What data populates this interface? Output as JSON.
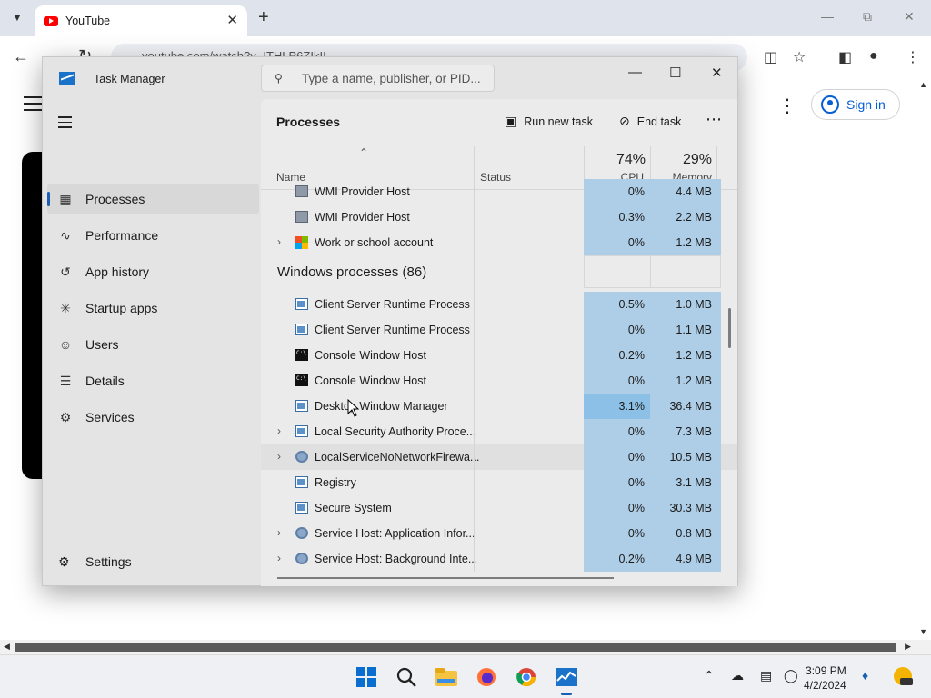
{
  "browser": {
    "tab_title": "YouTube",
    "url": "youtube.com/watch?v=ITHLP6ZIkII",
    "signin_label": "Sign in"
  },
  "tm": {
    "title": "Task Manager",
    "search_placeholder": "Type a name, publisher, or PID...",
    "nav": [
      {
        "label": "Processes",
        "icon": "processes-icon"
      },
      {
        "label": "Performance",
        "icon": "performance-icon"
      },
      {
        "label": "App history",
        "icon": "app-history-icon"
      },
      {
        "label": "Startup apps",
        "icon": "startup-apps-icon"
      },
      {
        "label": "Users",
        "icon": "users-icon"
      },
      {
        "label": "Details",
        "icon": "details-icon"
      },
      {
        "label": "Services",
        "icon": "services-icon"
      }
    ],
    "settings_label": "Settings",
    "heading": "Processes",
    "run_new_task": "Run new task",
    "end_task": "End task",
    "columns": {
      "name": "Name",
      "status": "Status",
      "cpu_pct": "74%",
      "cpu": "CPU",
      "mem_pct": "29%",
      "memory": "Memory"
    },
    "top_rows": [
      {
        "name": "WMI Provider Host",
        "cpu": "0%",
        "mem": "4.4 MB",
        "icon": "wmi"
      },
      {
        "name": "WMI Provider Host",
        "cpu": "0.3%",
        "mem": "2.2 MB",
        "icon": "wmi"
      },
      {
        "name": "Work or school account",
        "cpu": "0%",
        "mem": "1.2 MB",
        "icon": "ms",
        "expand": true
      }
    ],
    "section_title": "Windows processes (86)",
    "rows": [
      {
        "name": "Client Server Runtime Process",
        "cpu": "0.5%",
        "mem": "1.0 MB",
        "icon": "app"
      },
      {
        "name": "Client Server Runtime Process",
        "cpu": "0%",
        "mem": "1.1 MB",
        "icon": "app"
      },
      {
        "name": "Console Window Host",
        "cpu": "0.2%",
        "mem": "1.2 MB",
        "icon": "console"
      },
      {
        "name": "Console Window Host",
        "cpu": "0%",
        "mem": "1.2 MB",
        "icon": "console"
      },
      {
        "name": "Desktop Window Manager",
        "cpu": "3.1%",
        "mem": "36.4 MB",
        "icon": "app",
        "hot": true
      },
      {
        "name": "Local Security Authority Proce...",
        "cpu": "0%",
        "mem": "7.3 MB",
        "icon": "app",
        "expand": true
      },
      {
        "name": "LocalServiceNoNetworkFirewa...",
        "cpu": "0%",
        "mem": "10.5 MB",
        "icon": "gear",
        "expand": true,
        "hover": true
      },
      {
        "name": "Registry",
        "cpu": "0%",
        "mem": "3.1 MB",
        "icon": "app"
      },
      {
        "name": "Secure System",
        "cpu": "0%",
        "mem": "30.3 MB",
        "icon": "app"
      },
      {
        "name": "Service Host: Application Infor...",
        "cpu": "0%",
        "mem": "0.8 MB",
        "icon": "gear",
        "expand": true
      },
      {
        "name": "Service Host: Background Inte...",
        "cpu": "0.2%",
        "mem": "4.9 MB",
        "icon": "gear",
        "expand": true
      }
    ]
  },
  "taskbar": {
    "time": "3:09 PM",
    "date": "4/2/2024"
  }
}
